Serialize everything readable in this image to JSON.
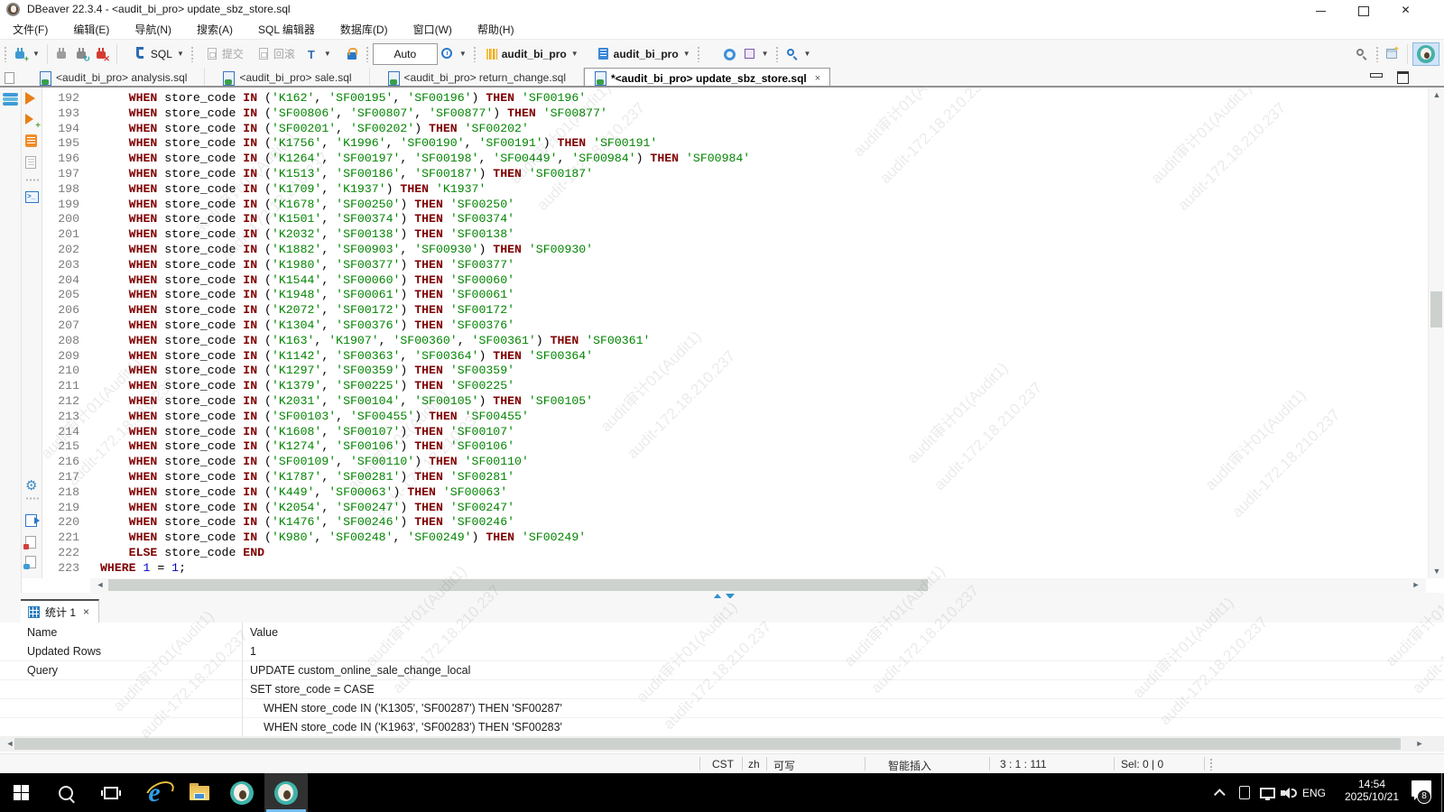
{
  "window": {
    "title": "DBeaver 22.3.4 - <audit_bi_pro> update_sbz_store.sql",
    "close_label": "✕"
  },
  "menubar": {
    "items": [
      "文件(F)",
      "编辑(E)",
      "导航(N)",
      "搜索(A)",
      "SQL 编辑器",
      "数据库(D)",
      "窗口(W)",
      "帮助(H)"
    ]
  },
  "toolbar": {
    "sql_label": "SQL",
    "commit_label": "提交",
    "rollback_label": "回滚",
    "auto_label": "Auto",
    "connection_name": "audit_bi_pro",
    "schema_name": "audit_bi_pro"
  },
  "tabs": [
    {
      "label": "<audit_bi_pro> analysis.sql",
      "active": false
    },
    {
      "label": "<audit_bi_pro> sale.sql",
      "active": false
    },
    {
      "label": "<audit_bi_pro> return_change.sql",
      "active": false
    },
    {
      "label": "*<audit_bi_pro> update_sbz_store.sql",
      "active": true,
      "close": "×"
    }
  ],
  "editor": {
    "first_line": 192,
    "keywords": [
      "WHEN",
      "IN",
      "THEN",
      "ELSE",
      "END",
      "WHERE"
    ],
    "lines": [
      "    WHEN store_code IN ('K162', 'SF00195', 'SF00196') THEN 'SF00196'",
      "    WHEN store_code IN ('SF00806', 'SF00807', 'SF00877') THEN 'SF00877'",
      "    WHEN store_code IN ('SF00201', 'SF00202') THEN 'SF00202'",
      "    WHEN store_code IN ('K1756', 'K1996', 'SF00190', 'SF00191') THEN 'SF00191'",
      "    WHEN store_code IN ('K1264', 'SF00197', 'SF00198', 'SF00449', 'SF00984') THEN 'SF00984'",
      "    WHEN store_code IN ('K1513', 'SF00186', 'SF00187') THEN 'SF00187'",
      "    WHEN store_code IN ('K1709', 'K1937') THEN 'K1937'",
      "    WHEN store_code IN ('K1678', 'SF00250') THEN 'SF00250'",
      "    WHEN store_code IN ('K1501', 'SF00374') THEN 'SF00374'",
      "    WHEN store_code IN ('K2032', 'SF00138') THEN 'SF00138'",
      "    WHEN store_code IN ('K1882', 'SF00903', 'SF00930') THEN 'SF00930'",
      "    WHEN store_code IN ('K1980', 'SF00377') THEN 'SF00377'",
      "    WHEN store_code IN ('K1544', 'SF00060') THEN 'SF00060'",
      "    WHEN store_code IN ('K1948', 'SF00061') THEN 'SF00061'",
      "    WHEN store_code IN ('K2072', 'SF00172') THEN 'SF00172'",
      "    WHEN store_code IN ('K1304', 'SF00376') THEN 'SF00376'",
      "    WHEN store_code IN ('K163', 'K1907', 'SF00360', 'SF00361') THEN 'SF00361'",
      "    WHEN store_code IN ('K1142', 'SF00363', 'SF00364') THEN 'SF00364'",
      "    WHEN store_code IN ('K1297', 'SF00359') THEN 'SF00359'",
      "    WHEN store_code IN ('K1379', 'SF00225') THEN 'SF00225'",
      "    WHEN store_code IN ('K2031', 'SF00104', 'SF00105') THEN 'SF00105'",
      "    WHEN store_code IN ('SF00103', 'SF00455') THEN 'SF00455'",
      "    WHEN store_code IN ('K1608', 'SF00107') THEN 'SF00107'",
      "    WHEN store_code IN ('K1274', 'SF00106') THEN 'SF00106'",
      "    WHEN store_code IN ('SF00109', 'SF00110') THEN 'SF00110'",
      "    WHEN store_code IN ('K1787', 'SF00281') THEN 'SF00281'",
      "    WHEN store_code IN ('K449', 'SF00063') THEN 'SF00063'",
      "    WHEN store_code IN ('K2054', 'SF00247') THEN 'SF00247'",
      "    WHEN store_code IN ('K1476', 'SF00246') THEN 'SF00246'",
      "    WHEN store_code IN ('K980', 'SF00248', 'SF00249') THEN 'SF00249'",
      "    ELSE store_code END",
      "WHERE 1 = 1;"
    ],
    "colors": {
      "keyword": "#7f0000",
      "string": "#008400",
      "number": "#0000c0",
      "text": "#000000",
      "line_number": "#7b7b7b"
    }
  },
  "watermark": {
    "line1": "audit审计01(Audit1)",
    "line2": "audit-172.18.210.237"
  },
  "bottom_panel": {
    "tab_label": "统计 1",
    "tab_close": "×",
    "headers": [
      "Name",
      "Value"
    ],
    "rows": [
      {
        "name": "Updated Rows",
        "value": "1",
        "indent": false
      },
      {
        "name": "Query",
        "value": "UPDATE custom_online_sale_change_local",
        "indent": false
      },
      {
        "name": "",
        "value": "SET store_code = CASE",
        "indent": false
      },
      {
        "name": "",
        "value": "WHEN store_code IN ('K1305', 'SF00287') THEN 'SF00287'",
        "indent": true
      },
      {
        "name": "",
        "value": "WHEN store_code IN ('K1963', 'SF00283') THEN 'SF00283'",
        "indent": true
      }
    ]
  },
  "statusbar": {
    "items": [
      "CST",
      "zh",
      "可写",
      "智能插入",
      "3 : 1 : 111",
      "Sel: 0 | 0"
    ]
  },
  "taskbar": {
    "lang": "ENG",
    "time": "14:54",
    "date": "2025/10/21",
    "badge": "8"
  }
}
